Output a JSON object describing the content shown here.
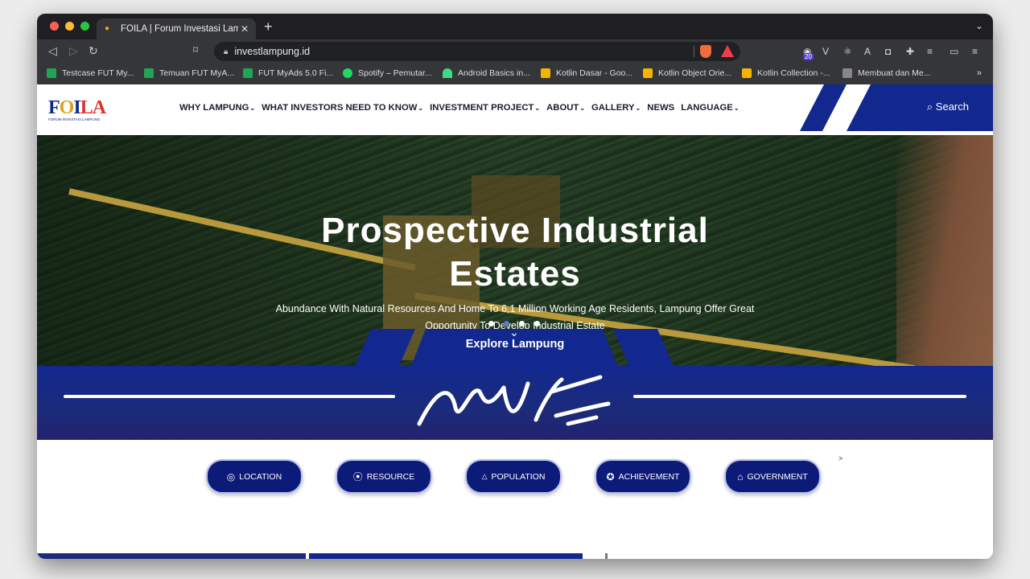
{
  "browser": {
    "tab_title": "FOILA | Forum Investasi Lampung",
    "url": "investlampung.id",
    "ext_badge": "20",
    "bookmarks": [
      "Testcase FUT My...",
      "Temuan FUT MyA...",
      "FUT MyAds 5.0 Fi...",
      "Spotify – Pemutar...",
      "Android Basics in...",
      "Kotlin Dasar - Goo...",
      "Kotlin Object Orie...",
      "Kotlin Collection -...",
      "Membuat dan Me..."
    ],
    "bookmarks_more": "»"
  },
  "site": {
    "logo_text_f": "F",
    "logo_text_o": "O",
    "logo_text_i": "I",
    "logo_text_la": "LA",
    "logo_sub": "FORUM INVESTASI LAMPUNG",
    "menu": [
      "WHY LAMPUNG",
      "WHAT INVESTORS NEED TO KNOW",
      "INVESTMENT PROJECT",
      "ABOUT",
      "GALLERY",
      "NEWS",
      "LANGUAGE"
    ],
    "search_label": "Search",
    "hero": {
      "title_line1": "Prospective Industrial",
      "title_line2": "Estates",
      "subtitle": "Abundance With Natural Resources And Home To 6,1 Million Working Age Residents, Lampung Offer Great Opportunity To Develop Industrial Estate"
    },
    "explore_label": "Explore Lampung",
    "categories": [
      "LOCATION",
      "RESOURCE",
      "POPULATION",
      "ACHIEVEMENT",
      "GOVERNMENT"
    ],
    "next_arrow": ">"
  },
  "colors": {
    "brand_blue": "#0c1a78",
    "band_blue": "#12288e",
    "tabbar": "#1f1f23",
    "toolbar": "#35363a"
  }
}
